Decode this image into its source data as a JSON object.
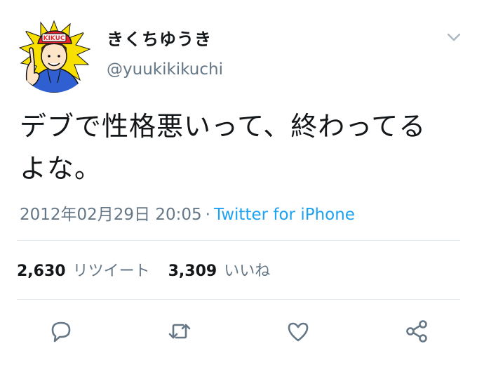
{
  "user": {
    "display_name": "きくちゆうき",
    "handle": "@yuukikikuchi",
    "avatar_label": "KIKUC"
  },
  "tweet": {
    "text": "デブで性格悪いって、終わってる\nよな。",
    "timestamp": "2012年02月29日 20:05",
    "separator": "·",
    "source": "Twitter for iPhone"
  },
  "stats": {
    "retweets": "2,630",
    "retweets_label": "リツイート",
    "likes": "3,309",
    "likes_label": "いいね"
  },
  "icons": {
    "menu": "chevron-down-icon",
    "reply": "reply-icon",
    "retweet": "retweet-icon",
    "like": "heart-icon",
    "share": "share-icon"
  },
  "colors": {
    "text": "#14171a",
    "secondary": "#657786",
    "link": "#1da1f2",
    "divider": "#e1e8ed",
    "avatar_burst": "#f7e000",
    "avatar_cap": "#e8232d",
    "avatar_hoodie": "#2f5fd0"
  }
}
